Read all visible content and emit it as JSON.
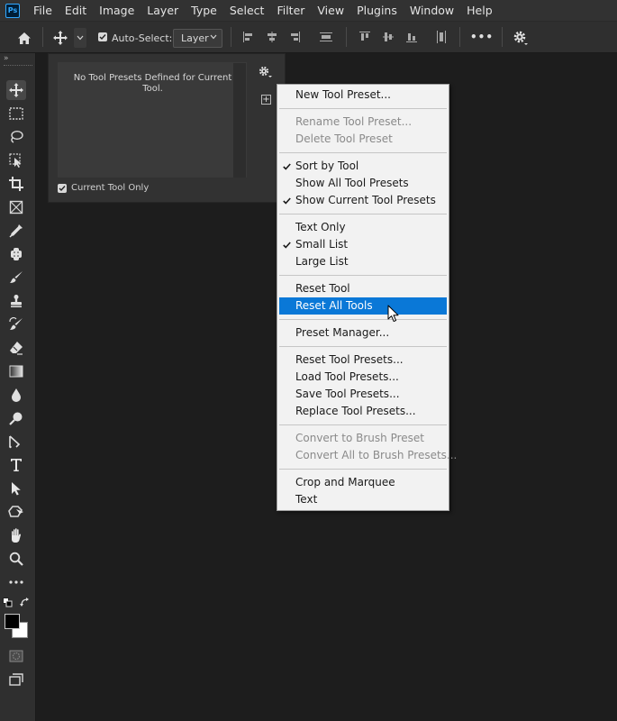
{
  "app": {
    "logo": "Ps"
  },
  "menubar": {
    "items": [
      "File",
      "Edit",
      "Image",
      "Layer",
      "Type",
      "Select",
      "Filter",
      "View",
      "Plugins",
      "Window",
      "Help"
    ]
  },
  "options_bar": {
    "auto_select_label": "Auto-Select:",
    "auto_select_checked": true,
    "layer_select_value": "Layer",
    "more_label": "•••"
  },
  "tool_presets_panel": {
    "empty_message": "No Tool Presets Defined for Current Tool.",
    "current_tool_only_label": "Current Tool Only",
    "current_tool_only_checked": true
  },
  "context_menu": {
    "sections": [
      [
        {
          "label": "New Tool Preset...",
          "enabled": true,
          "checked": false,
          "selected": false
        }
      ],
      [
        {
          "label": "Rename Tool Preset...",
          "enabled": false,
          "checked": false,
          "selected": false
        },
        {
          "label": "Delete Tool Preset",
          "enabled": false,
          "checked": false,
          "selected": false
        }
      ],
      [
        {
          "label": "Sort by Tool",
          "enabled": true,
          "checked": true,
          "selected": false
        },
        {
          "label": "Show All Tool Presets",
          "enabled": true,
          "checked": false,
          "selected": false
        },
        {
          "label": "Show Current Tool Presets",
          "enabled": true,
          "checked": true,
          "selected": false
        }
      ],
      [
        {
          "label": "Text Only",
          "enabled": true,
          "checked": false,
          "selected": false
        },
        {
          "label": "Small List",
          "enabled": true,
          "checked": true,
          "selected": false
        },
        {
          "label": "Large List",
          "enabled": true,
          "checked": false,
          "selected": false
        }
      ],
      [
        {
          "label": "Reset Tool",
          "enabled": true,
          "checked": false,
          "selected": false
        },
        {
          "label": "Reset All Tools",
          "enabled": true,
          "checked": false,
          "selected": true
        }
      ],
      [
        {
          "label": "Preset Manager...",
          "enabled": true,
          "checked": false,
          "selected": false
        }
      ],
      [
        {
          "label": "Reset Tool Presets...",
          "enabled": true,
          "checked": false,
          "selected": false
        },
        {
          "label": "Load Tool Presets...",
          "enabled": true,
          "checked": false,
          "selected": false
        },
        {
          "label": "Save Tool Presets...",
          "enabled": true,
          "checked": false,
          "selected": false
        },
        {
          "label": "Replace Tool Presets...",
          "enabled": true,
          "checked": false,
          "selected": false
        }
      ],
      [
        {
          "label": "Convert to Brush Preset",
          "enabled": false,
          "checked": false,
          "selected": false
        },
        {
          "label": "Convert All to Brush Presets...",
          "enabled": false,
          "checked": false,
          "selected": false
        }
      ],
      [
        {
          "label": "Crop and Marquee",
          "enabled": true,
          "checked": false,
          "selected": false
        },
        {
          "label": "Text",
          "enabled": true,
          "checked": false,
          "selected": false
        }
      ]
    ]
  },
  "colors": {
    "accent": "#0a78d7",
    "foreground_swatch": "#000000",
    "background_swatch": "#ffffff"
  },
  "tools": [
    "move-icon",
    "marquee-icon",
    "lasso-icon",
    "object-select-icon",
    "crop-icon",
    "frame-icon",
    "eyedropper-icon",
    "healing-brush-icon",
    "brush-icon",
    "clone-stamp-icon",
    "history-brush-icon",
    "eraser-icon",
    "gradient-icon",
    "blur-icon",
    "dodge-icon",
    "pen-icon",
    "type-icon",
    "path-select-icon",
    "shape-icon",
    "hand-icon",
    "zoom-icon",
    "more-tools-icon"
  ]
}
